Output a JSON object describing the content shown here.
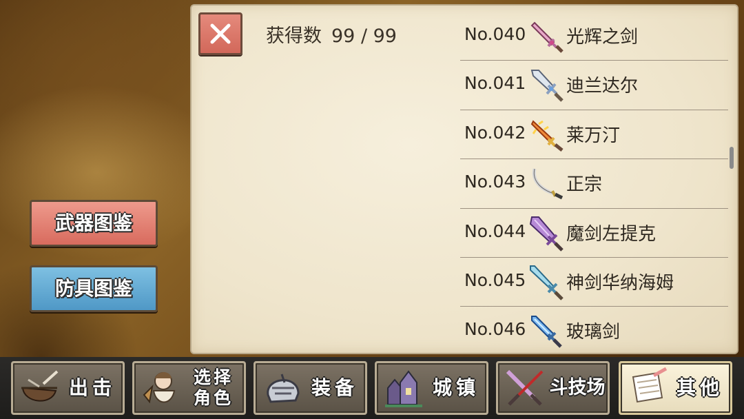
{
  "header": {
    "count_label": "获得数",
    "count_value": "99 / 99"
  },
  "side_buttons": {
    "weapon": "武器图鉴",
    "armor": "防具图鉴"
  },
  "items": [
    {
      "no": "No.040",
      "name": "光辉之剑",
      "icon": "pink-jeweled-sword-icon"
    },
    {
      "no": "No.041",
      "name": "迪兰达尔",
      "icon": "white-ornate-sword-icon"
    },
    {
      "no": "No.042",
      "name": "莱万汀",
      "icon": "flaming-sword-icon"
    },
    {
      "no": "No.043",
      "name": "正宗",
      "icon": "katana-icon"
    },
    {
      "no": "No.044",
      "name": "魔剑左提克",
      "icon": "demon-sword-icon"
    },
    {
      "no": "No.045",
      "name": "神剑华纳海姆",
      "icon": "holy-blue-sword-icon"
    },
    {
      "no": "No.046",
      "name": "玻璃剑",
      "icon": "glass-sword-icon"
    }
  ],
  "tabs": [
    {
      "label": "出击",
      "icon": "pot-icon"
    },
    {
      "label": "选择\n角色",
      "icon": "character-icon"
    },
    {
      "label": "装备",
      "icon": "helmet-icon"
    },
    {
      "label": "城镇",
      "icon": "town-icon"
    },
    {
      "label": "斗技场",
      "icon": "crossed-swords-icon"
    },
    {
      "label": "其他",
      "icon": "scroll-icon",
      "active": true
    }
  ],
  "colors": {
    "close_button": "#d86b5e",
    "weapon_button": "#e3837a",
    "armor_button": "#62a9d4",
    "panel": "#f2e9d2"
  }
}
